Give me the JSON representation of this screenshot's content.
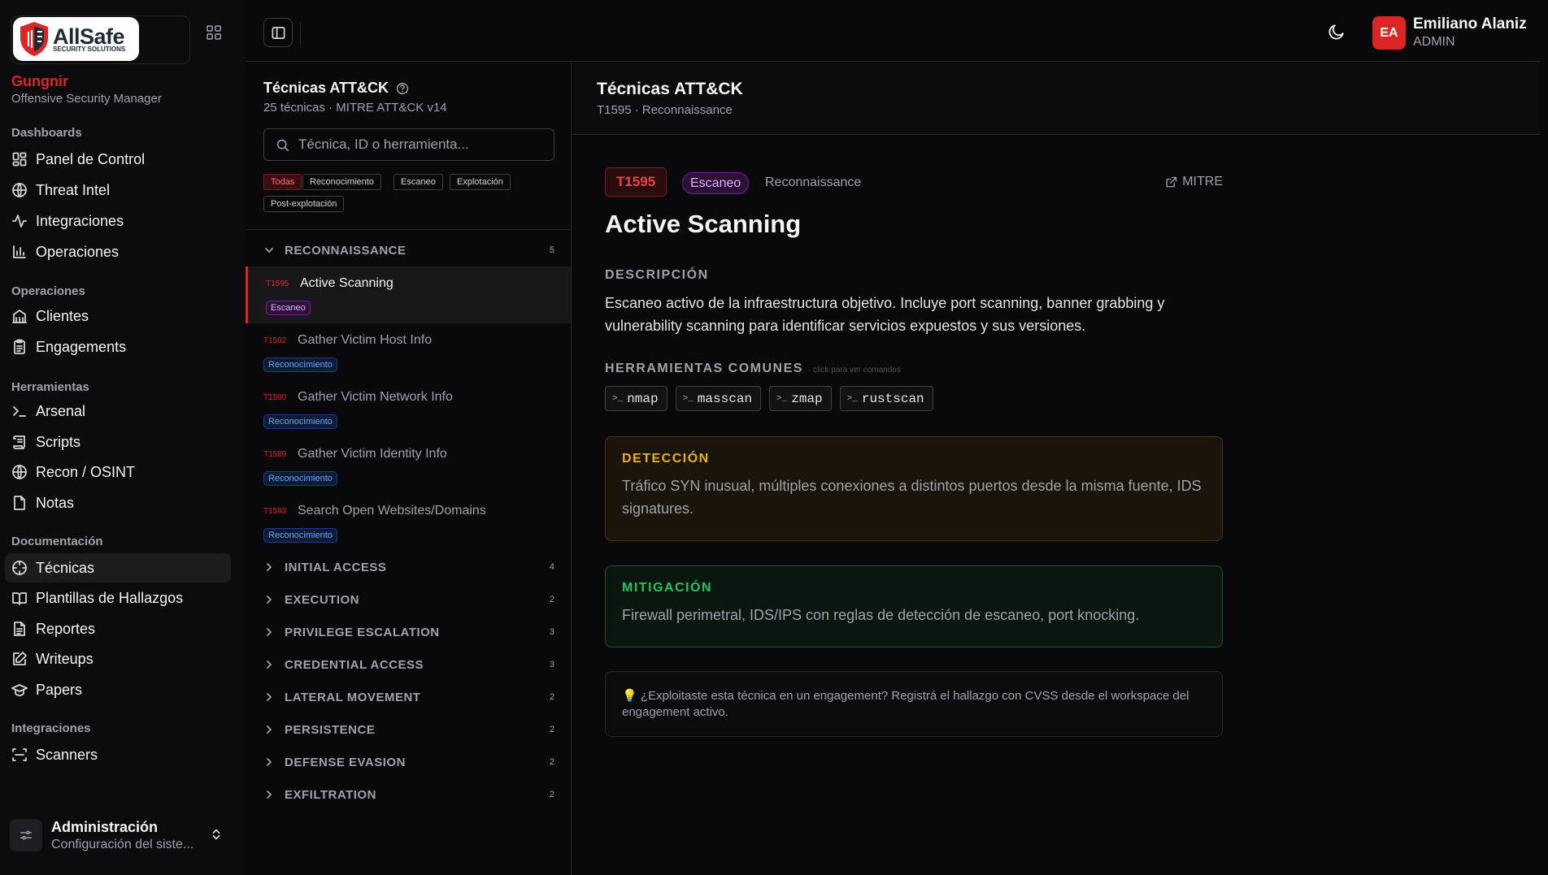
{
  "sidebar": {
    "logo": {
      "brand": "AllSafe",
      "tagline": "SECURITY SOLUTIONS"
    },
    "org_name": "Gungnir",
    "org_role": "Offensive Security Manager",
    "sections": [
      {
        "title": "Dashboards",
        "items": [
          {
            "label": "Panel de Control",
            "icon": "dashboard-icon"
          },
          {
            "label": "Threat Intel",
            "icon": "globe-icon"
          },
          {
            "label": "Integraciones",
            "icon": "activity-icon"
          },
          {
            "label": "Operaciones",
            "icon": "bar-chart-icon"
          }
        ]
      },
      {
        "title": "Operaciones",
        "items": [
          {
            "label": "Clientes",
            "icon": "building-icon"
          },
          {
            "label": "Engagements",
            "icon": "clipboard-icon"
          }
        ]
      },
      {
        "title": "Herramientas",
        "items": [
          {
            "label": "Arsenal",
            "icon": "terminal-icon"
          },
          {
            "label": "Scripts",
            "icon": "scroll-icon"
          },
          {
            "label": "Recon / OSINT",
            "icon": "globe-icon"
          },
          {
            "label": "Notas",
            "icon": "note-icon"
          }
        ]
      },
      {
        "title": "Documentación",
        "items": [
          {
            "label": "Técnicas",
            "icon": "crosshair-icon",
            "active": true
          },
          {
            "label": "Plantillas de Hallazgos",
            "icon": "book-icon"
          },
          {
            "label": "Reportes",
            "icon": "file-text-icon"
          },
          {
            "label": "Writeups",
            "icon": "edit-icon"
          },
          {
            "label": "Papers",
            "icon": "graduation-cap-icon"
          }
        ]
      },
      {
        "title": "Integraciones",
        "items": [
          {
            "label": "Scanners",
            "icon": "scan-icon"
          }
        ]
      }
    ],
    "admin": {
      "title": "Administración",
      "subtitle": "Configuración del siste..."
    }
  },
  "topbar": {
    "user": {
      "initials": "EA",
      "name": "Emiliano Alaniz",
      "role": "ADMIN"
    },
    "accent": "#dc2626"
  },
  "list": {
    "title": "Técnicas ATT&CK",
    "subtitle": "25 técnicas · MITRE ATT&CK v14",
    "search_placeholder": "Técnica, ID o herramienta...",
    "filters": [
      "Todas",
      "Reconocimiento",
      "Escaneo",
      "Explotación",
      "Post-explotación"
    ],
    "active_filter": "Todas",
    "categories": [
      {
        "name": "RECONNAISSANCE",
        "count": "5",
        "expanded": true,
        "techniques": [
          {
            "id": "T1595",
            "name": "Active Scanning",
            "badge": "Escaneo",
            "selected": true
          },
          {
            "id": "T1592",
            "name": "Gather Victim Host Info",
            "badge": "Reconocimiento"
          },
          {
            "id": "T1590",
            "name": "Gather Victim Network Info",
            "badge": "Reconocimiento"
          },
          {
            "id": "T1589",
            "name": "Gather Victim Identity Info",
            "badge": "Reconocimiento"
          },
          {
            "id": "T1593",
            "name": "Search Open Websites/Domains",
            "badge": "Reconocimiento"
          }
        ]
      },
      {
        "name": "INITIAL ACCESS",
        "count": "4"
      },
      {
        "name": "EXECUTION",
        "count": "2"
      },
      {
        "name": "PRIVILEGE ESCALATION",
        "count": "3"
      },
      {
        "name": "CREDENTIAL ACCESS",
        "count": "3"
      },
      {
        "name": "LATERAL MOVEMENT",
        "count": "2"
      },
      {
        "name": "PERSISTENCE",
        "count": "2"
      },
      {
        "name": "DEFENSE EVASION",
        "count": "2"
      },
      {
        "name": "EXFILTRATION",
        "count": "2"
      }
    ]
  },
  "detail": {
    "header_title": "Técnicas ATT&CK",
    "header_sub": "T1595 · Reconnaissance",
    "id": "T1595",
    "category": "Escaneo",
    "tactic": "Reconnaissance",
    "mitre_link": "MITRE",
    "title": "Active Scanning",
    "desc_label": "DESCRIPCIÓN",
    "description": "Escaneo activo de la infraestructura objetivo. Incluye port scanning, banner grabbing y vulnerability scanning para identificar servicios expuestos y sus versiones.",
    "tools_label": "HERRAMIENTAS COMUNES",
    "tools_hint": "· click para ver comandos",
    "tools": [
      "nmap",
      "masscan",
      "zmap",
      "rustscan"
    ],
    "detection_label": "DETECCIÓN",
    "detection": "Tráfico SYN inusual, múltiples conexiones a distintos puertos desde la misma fuente, IDS signatures.",
    "mitigation_label": "MITIGACIÓN",
    "mitigation": "Firewall perimetral, IDS/IPS con reglas de detección de escaneo, port knocking.",
    "tip": "💡 ¿Exploitaste esta técnica en un engagement? Registrá el hallazgo con CVSS desde el workspace del engagement activo."
  }
}
